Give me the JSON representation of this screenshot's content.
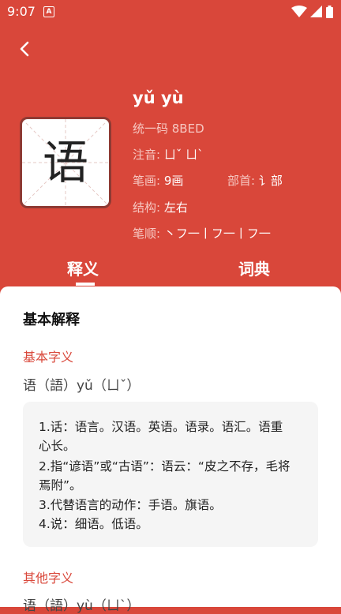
{
  "status": {
    "time": "9:07",
    "notif_icon": "A"
  },
  "header": {
    "pinyin": "yǔ yù",
    "character": "语",
    "unicode": "统一码 8BED",
    "zhuyin_label": "注音:",
    "zhuyin_value": "ㄩˇ ㄩˋ",
    "strokes_label": "笔画:",
    "strokes_value": "9画",
    "radical_label": "部首:",
    "radical_value": "讠部",
    "structure_label": "结构:",
    "structure_value": "左右",
    "order_label": "笔顺:",
    "order_value": "丶フ一丨フ一丨フ一"
  },
  "tabs": [
    {
      "label": "释义",
      "active": true
    },
    {
      "label": "词典",
      "active": false
    }
  ],
  "content": {
    "section_title": "基本解释",
    "basic_title": "基本字义",
    "basic_reading": "语（語）yǔ（ㄩˇ）",
    "definitions": [
      "1.话：语言。汉语。英语。语录。语汇。语重",
      "心长。",
      "2.指“谚语”或“古语”：语云：“皮之不存，毛将",
      "焉附”。",
      "3.代替语言的动作：手语。旗语。",
      "4.说：细语。低语。"
    ],
    "other_title": "其他字义",
    "other_reading": "语（語）yù（ㄩˋ）"
  },
  "colors": {
    "accent": "#d9473a",
    "box_border": "#8e3a33"
  }
}
